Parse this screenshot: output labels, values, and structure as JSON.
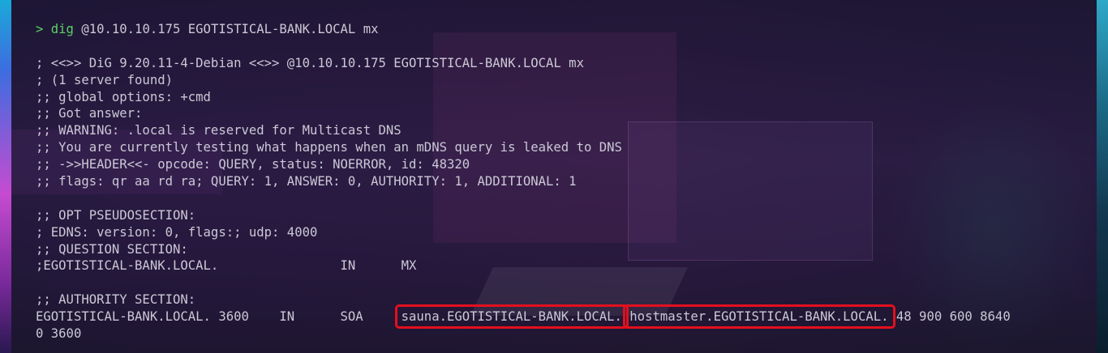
{
  "terminal": {
    "prompt_symbol": ">",
    "command_name": "dig",
    "command_args": " @10.10.10.175 EGOTISTICAL-BANK.LOCAL mx",
    "output": [
      "",
      "; <<>> DiG 9.20.11-4-Debian <<>> @10.10.10.175 EGOTISTICAL-BANK.LOCAL mx",
      "; (1 server found)",
      ";; global options: +cmd",
      ";; Got answer:",
      ";; WARNING: .local is reserved for Multicast DNS",
      ";; You are currently testing what happens when an mDNS query is leaked to DNS",
      ";; ->>HEADER<<- opcode: QUERY, status: NOERROR, id: 48320",
      ";; flags: qr aa rd ra; QUERY: 1, ANSWER: 0, AUTHORITY: 1, ADDITIONAL: 1",
      "",
      ";; OPT PSEUDOSECTION:",
      "; EDNS: version: 0, flags:; udp: 4000",
      ";; QUESTION SECTION:",
      ";EGOTISTICAL-BANK.LOCAL.                IN      MX",
      "",
      ";; AUTHORITY SECTION:"
    ],
    "soa_record": {
      "prefix": "EGOTISTICAL-BANK.LOCAL. 3600    IN      SOA     ",
      "primary_ns": "sauna.EGOTISTICAL-BANK.LOCAL.",
      "responsible": "hostmaster.EGOTISTICAL-BANK.LOCAL.",
      "suffix": " 48 900 600 8640",
      "wrap": "0 3600"
    },
    "colors": {
      "prompt": "#5bd163",
      "text": "#cbc8d6",
      "highlight_box": "#e3101e"
    }
  }
}
